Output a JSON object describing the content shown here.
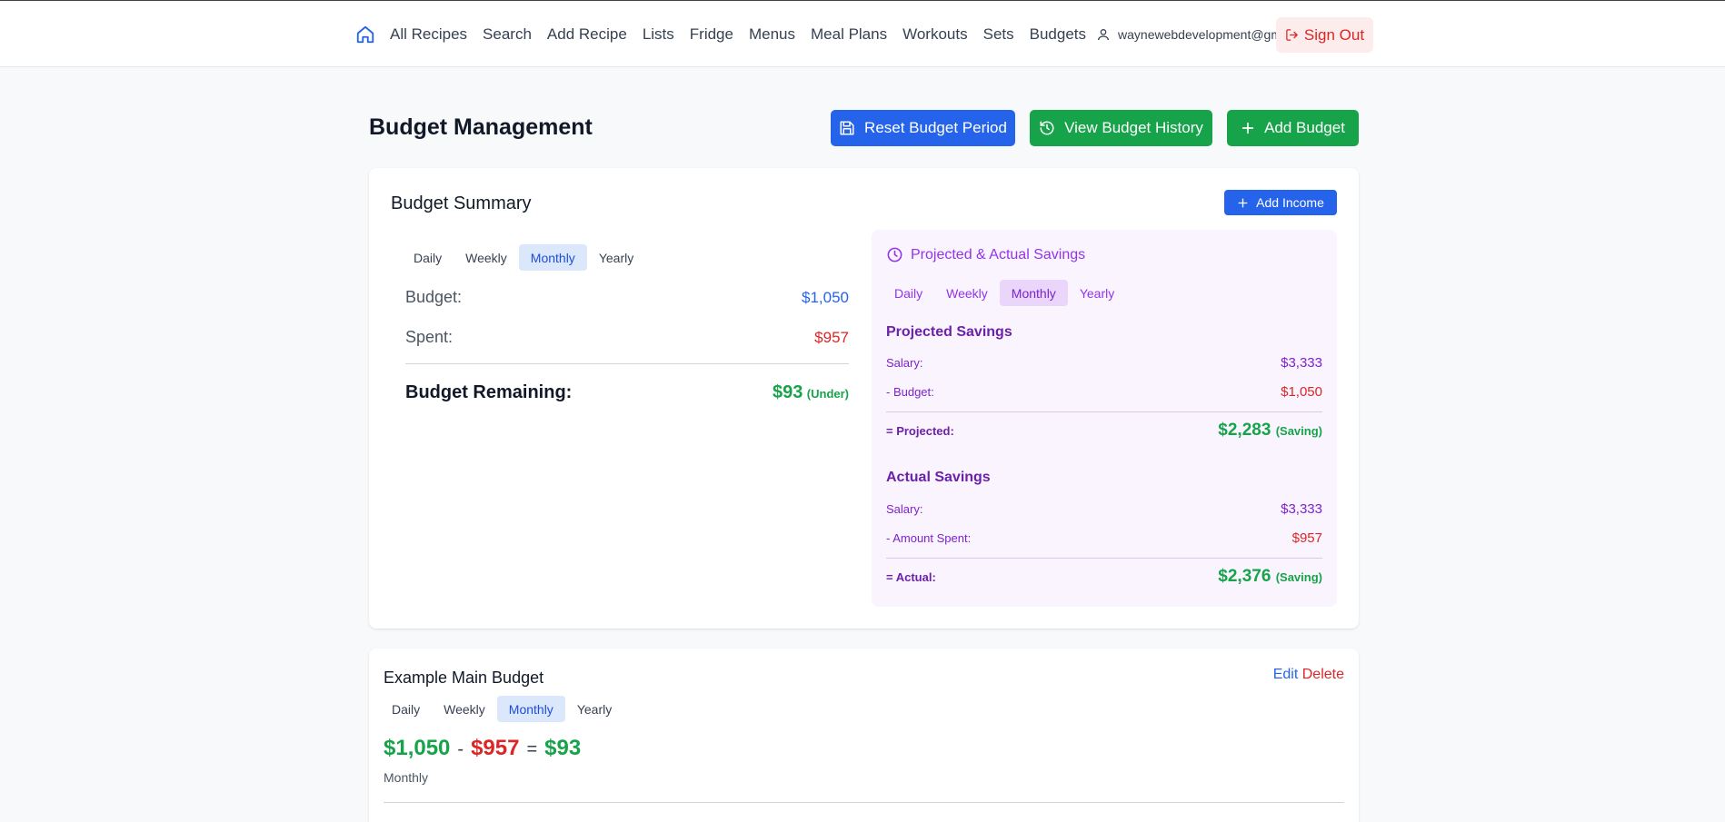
{
  "nav": {
    "links": [
      "All Recipes",
      "Search",
      "Add Recipe",
      "Lists",
      "Fridge",
      "Menus",
      "Meal Plans",
      "Workouts",
      "Sets",
      "Budgets"
    ],
    "email": "waynewebdevelopment@gmail.com",
    "sign_out": "Sign Out"
  },
  "header": {
    "title": "Budget Management",
    "reset_label": "Reset Budget Period",
    "history_label": "View Budget History",
    "add_label": "Add Budget"
  },
  "summary": {
    "title": "Budget Summary",
    "add_income_label": "Add Income",
    "tabs": [
      "Daily",
      "Weekly",
      "Monthly",
      "Yearly"
    ],
    "active_tab": "Monthly",
    "budget_label": "Budget:",
    "budget_value": "$1,050",
    "spent_label": "Spent:",
    "spent_value": "$957",
    "remaining_label": "Budget Remaining:",
    "remaining_value": "$93",
    "remaining_status": "(Under)"
  },
  "savings": {
    "title": "Projected & Actual Savings",
    "tabs": [
      "Daily",
      "Weekly",
      "Monthly",
      "Yearly"
    ],
    "active_tab": "Monthly",
    "projected": {
      "title": "Projected Savings",
      "salary_label": "Salary:",
      "salary_value": "$3,333",
      "budget_label": "- Budget:",
      "budget_value": "$1,050",
      "total_label": "= Projected:",
      "total_value": "$2,283",
      "total_status": "(Saving)"
    },
    "actual": {
      "title": "Actual Savings",
      "salary_label": "Salary:",
      "salary_value": "$3,333",
      "spent_label": "- Amount Spent:",
      "spent_value": "$957",
      "total_label": "= Actual:",
      "total_value": "$2,376",
      "total_status": "(Saving)"
    }
  },
  "budget": {
    "name": "Example Main Budget",
    "edit_label": "Edit",
    "delete_label": "Delete",
    "tabs": [
      "Daily",
      "Weekly",
      "Monthly",
      "Yearly"
    ],
    "active_tab": "Monthly",
    "amount": "$1,050",
    "minus": "-",
    "spent": "$957",
    "equals": "=",
    "remaining": "$93",
    "period": "Monthly"
  },
  "colors": {
    "primary_blue": "#2563eb",
    "success_green": "#16a34a",
    "danger_red": "#dc2626",
    "savings_purple": "#7e22ce"
  }
}
